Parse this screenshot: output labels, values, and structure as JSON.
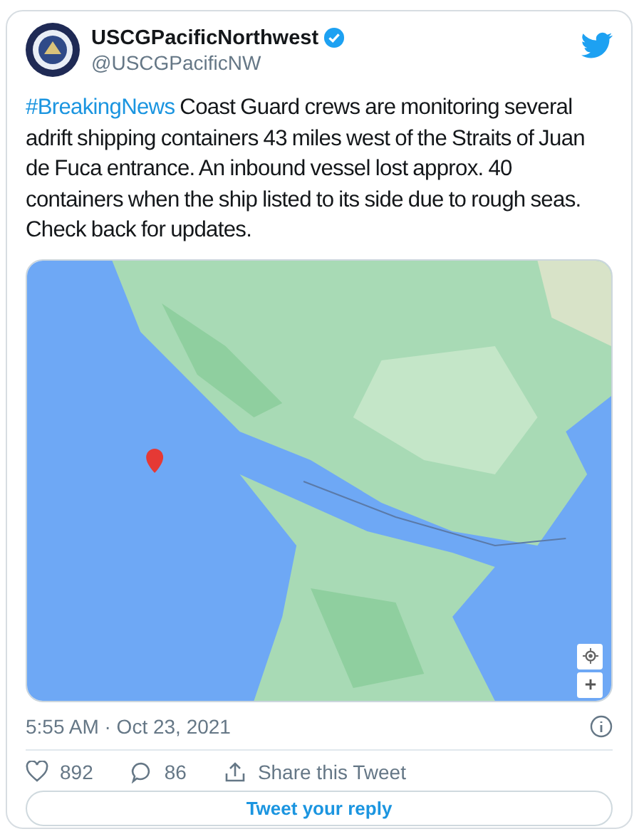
{
  "account": {
    "name": "USCGPacificNorthwest",
    "handle": "@USCGPacificNW",
    "verified": true
  },
  "tweet": {
    "hashtag": "#BreakingNews",
    "body": " Coast Guard crews are monitoring several adrift shipping containers 43 miles west of the Straits of Juan de Fuca entrance. An inbound vessel lost approx. 40 containers when the ship listed to its side due to rough seas. Check back for updates."
  },
  "timestamp": "5:55 AM · Oct 23, 2021",
  "actions": [
    {
      "kind": "like",
      "label": "892"
    },
    {
      "kind": "reply",
      "label": "86"
    },
    {
      "kind": "share",
      "label": "Share this Tweet"
    }
  ],
  "reply_button": "Tweet your reply"
}
